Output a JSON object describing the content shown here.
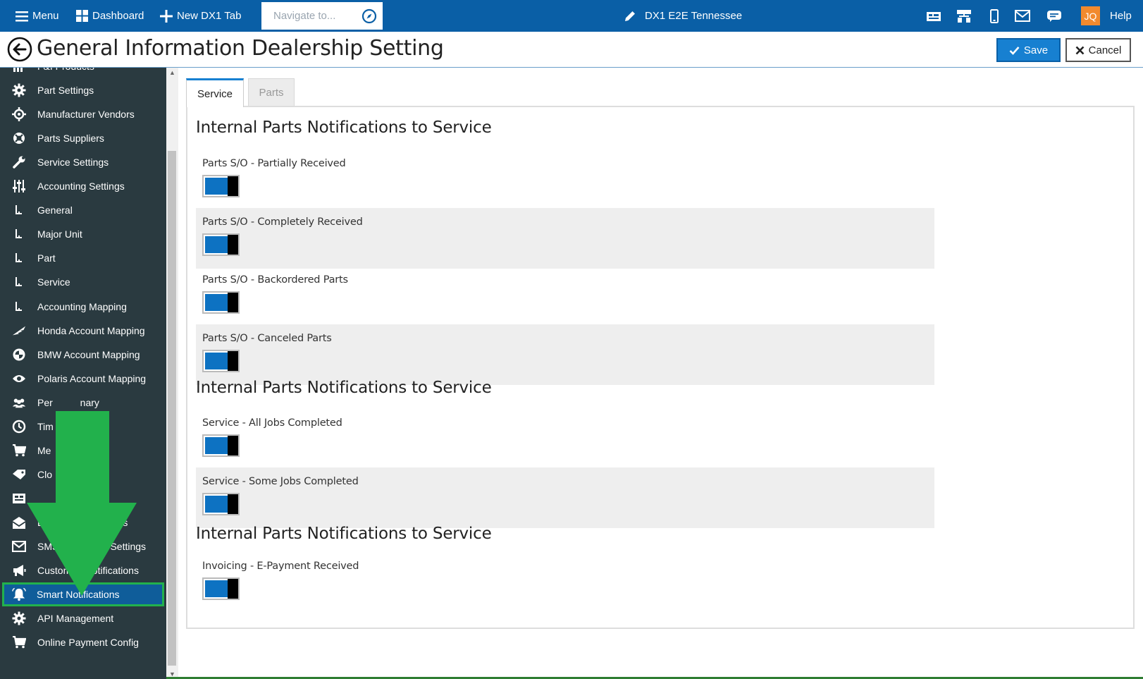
{
  "topbar": {
    "menu_label": "Menu",
    "dashboard_label": "Dashboard",
    "new_tab_label": "New DX1 Tab",
    "navigate_placeholder": "Navigate to...",
    "store_name": "DX1 E2E Tennessee",
    "avatar_initials": "JQ",
    "help_label": "Help",
    "brand_color": "#0a5fa6"
  },
  "titlebar": {
    "title": "General Information Dealership Setting",
    "save_label": "Save",
    "cancel_label": "Cancel"
  },
  "sidebar": {
    "items": [
      {
        "label": "F&I Products",
        "icon": "chart-icon"
      },
      {
        "label": "Part Settings",
        "icon": "gear-icon"
      },
      {
        "label": "Manufacturer Vendors",
        "icon": "crosshair-icon"
      },
      {
        "label": "Parts Suppliers",
        "icon": "lifebuoy-icon"
      },
      {
        "label": "Service Settings",
        "icon": "wrench-icon"
      },
      {
        "label": "Accounting Settings",
        "icon": "sliders-icon"
      },
      {
        "label": "General",
        "icon": "subitem-icon"
      },
      {
        "label": "Major Unit",
        "icon": "subitem-icon"
      },
      {
        "label": "Part",
        "icon": "subitem-icon"
      },
      {
        "label": "Service",
        "icon": "subitem-icon"
      },
      {
        "label": "Accounting Mapping",
        "icon": "subitem-icon"
      },
      {
        "label": "Honda Account Mapping",
        "icon": "wing-icon"
      },
      {
        "label": "BMW Account Mapping",
        "icon": "bmw-icon"
      },
      {
        "label": "Polaris Account Mapping",
        "icon": "eye-icon"
      },
      {
        "label": "Per          nary",
        "icon": "users-icon"
      },
      {
        "label": "Tim",
        "icon": "clock-icon"
      },
      {
        "label": "Me                ent",
        "icon": "cart-icon"
      },
      {
        "label": "Clo",
        "icon": "tag-icon"
      },
      {
        "label": "",
        "icon": "grid-icon"
      },
      {
        "label": "En                  ettings",
        "icon": "envelope-open-icon"
      },
      {
        "label": "SMS                s Settings",
        "icon": "envelope-icon"
      },
      {
        "label": "Custome   Notifications",
        "icon": "megaphone-icon"
      },
      {
        "label": "Smart Notifications",
        "icon": "bell-icon"
      },
      {
        "label": "API Management",
        "icon": "gear-icon"
      },
      {
        "label": "Online Payment Config",
        "icon": "cart-icon"
      }
    ],
    "active_index": 22
  },
  "tabs": {
    "service": "Service",
    "parts": "Parts"
  },
  "sections": [
    {
      "title": "Internal Parts Notifications to Service",
      "rows": [
        {
          "label": "Parts S/O - Partially Received",
          "on": true
        },
        {
          "label": "Parts S/O - Completely Received",
          "on": true
        },
        {
          "label": "Parts S/O - Backordered Parts",
          "on": true
        },
        {
          "label": "Parts S/O - Canceled Parts",
          "on": true
        }
      ]
    },
    {
      "title": "Internal Parts Notifications to Service",
      "rows": [
        {
          "label": "Service - All Jobs Completed",
          "on": true
        },
        {
          "label": "Service - Some Jobs Completed",
          "on": true
        }
      ]
    },
    {
      "title": "Internal Parts Notifications to Service",
      "rows": [
        {
          "label": "Invoicing - E-Payment Received",
          "on": true
        }
      ]
    }
  ],
  "colors": {
    "accent": "#1780d1",
    "sidebar_bg": "#2a3a40",
    "highlight": "#22b14c"
  }
}
